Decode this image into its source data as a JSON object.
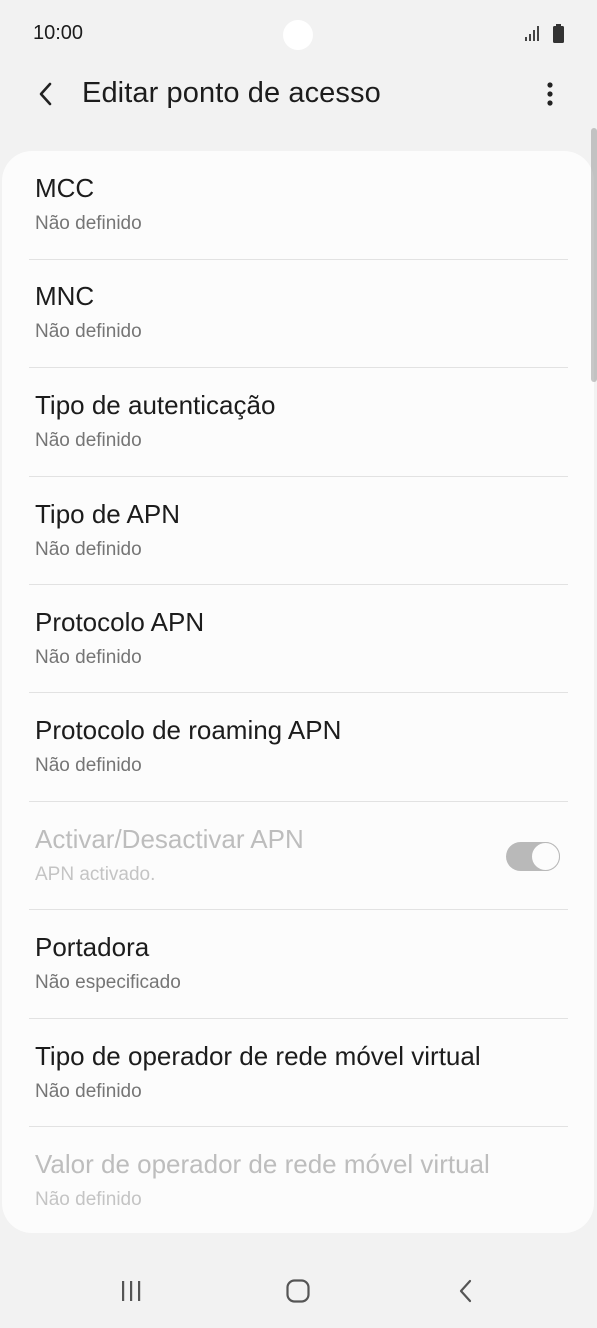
{
  "status_bar": {
    "time": "10:00",
    "icons": [
      "camera-cutout",
      "signal-icon",
      "battery-icon"
    ]
  },
  "header": {
    "back_icon": "chevron-left-icon",
    "title": "Editar ponto de acesso",
    "more_icon": "more-vertical-icon"
  },
  "settings": [
    {
      "label": "MCC",
      "value": "Não definido"
    },
    {
      "label": "MNC",
      "value": "Não definido"
    },
    {
      "label": "Tipo de autenticação",
      "value": "Não definido"
    },
    {
      "label": "Tipo de APN",
      "value": "Não definido"
    },
    {
      "label": "Protocolo APN",
      "value": "Não definido"
    },
    {
      "label": "Protocolo de roaming APN",
      "value": "Não definido"
    },
    {
      "label": "Activar/Desactivar APN",
      "value": "APN activado.",
      "disabled": true,
      "toggle_on": true
    },
    {
      "label": "Portadora",
      "value": "Não especificado"
    },
    {
      "label": "Tipo de operador de rede móvel virtual",
      "value": "Não definido"
    },
    {
      "label": "Valor de operador de rede móvel virtual",
      "value": "Não definido",
      "disabled": true
    }
  ],
  "nav_bar": {
    "recents_icon": "recents-icon",
    "home_icon": "home-icon",
    "back_icon": "back-icon"
  },
  "colors": {
    "background": "#f2f2f2",
    "card": "#fcfcfc",
    "text_primary": "#1c1c1c",
    "text_secondary": "#757575",
    "text_disabled": "#bdbdbd"
  }
}
